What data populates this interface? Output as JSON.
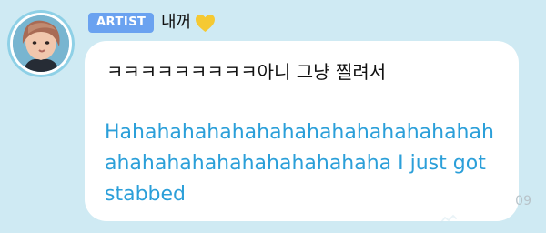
{
  "message": {
    "badge": "ARTIST",
    "sender": "내꺼",
    "sender_icon": "yellow-heart-icon",
    "original_text": "ㅋㅋㅋㅋㅋㅋㅋㅋㅋ아니 그냥 찔려서",
    "translated_text": "Hahahahahahahahahahahahahahahahahahahahahahahahahahaha I just got stabbed",
    "timestamp_partial": "09"
  },
  "colors": {
    "background": "#cfeaf3",
    "badge": "#6aa2f0",
    "translation_text": "#2b9fd9",
    "heart": "#f5c932"
  }
}
